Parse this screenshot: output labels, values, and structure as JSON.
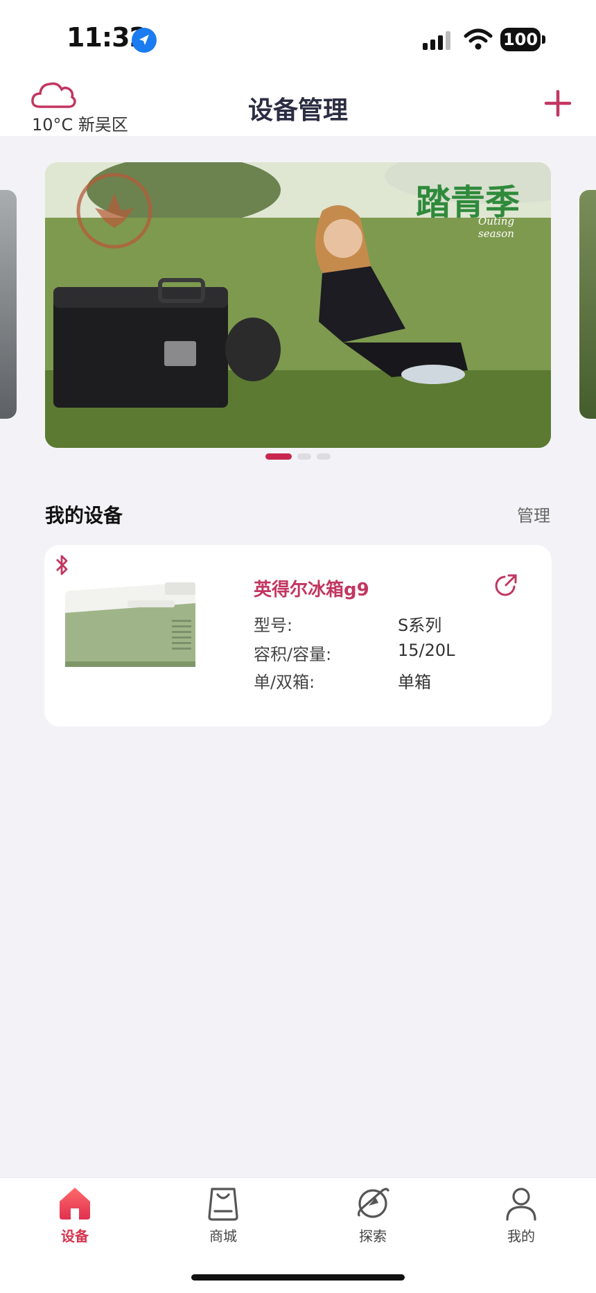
{
  "status_bar": {
    "time": "11:32",
    "battery": "100"
  },
  "header": {
    "weather": "10°C 新吴区",
    "title": "设备管理",
    "add_icon": "plus-icon"
  },
  "banner": {
    "brand": "踏青季",
    "subtitle": "Outing season",
    "dots": 3,
    "active_dot": 0
  },
  "devices_section": {
    "title": "我的设备",
    "manage": "管理"
  },
  "device": {
    "name": "英得尔冰箱g9",
    "specs": [
      {
        "label": "型号:",
        "value": "S系列"
      },
      {
        "label": "容积/容量:",
        "value": "15/20L"
      },
      {
        "label": "单/双箱:",
        "value": "单箱"
      }
    ]
  },
  "tabs": [
    {
      "label": "设备",
      "icon": "home-icon",
      "active": true
    },
    {
      "label": "商城",
      "icon": "bag-icon",
      "active": false
    },
    {
      "label": "探索",
      "icon": "compass-icon",
      "active": false
    },
    {
      "label": "我的",
      "icon": "user-icon",
      "active": false
    }
  ],
  "colors": {
    "accent": "#d6334d",
    "background": "#f3f3f7"
  }
}
